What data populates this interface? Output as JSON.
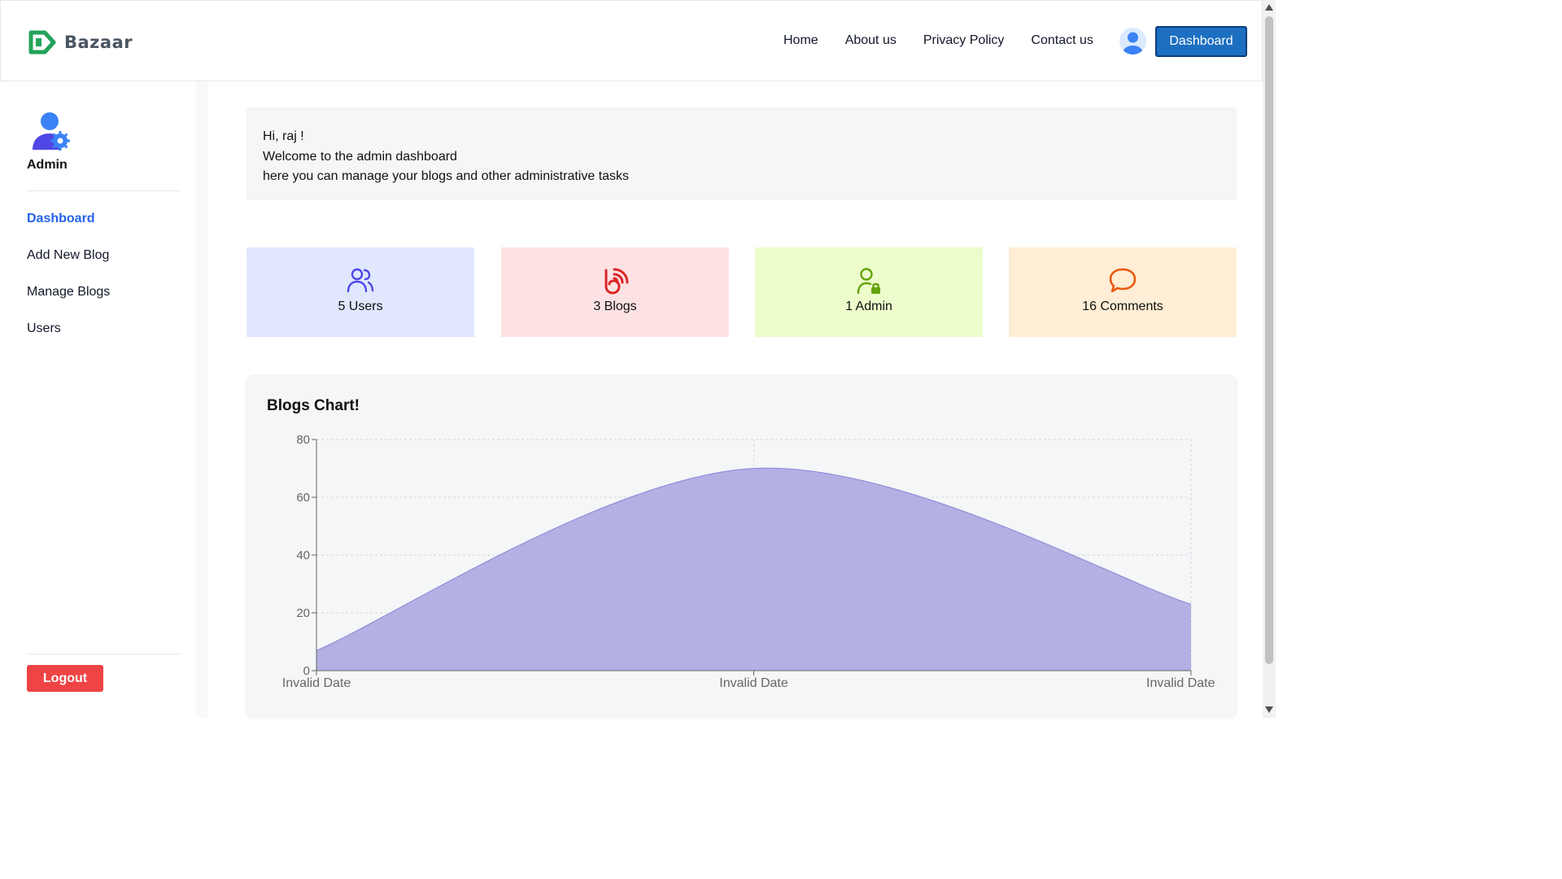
{
  "brand": {
    "name": "Bazaar",
    "accent": "#1d6fc1"
  },
  "nav": {
    "links": [
      "Home",
      "About us",
      "Privacy Policy",
      "Contact us"
    ],
    "avatar_icon": "user-avatar-icon",
    "dashboard_button": "Dashboard"
  },
  "sidebar": {
    "role_label": "Admin",
    "items": [
      {
        "label": "Dashboard",
        "active": true
      },
      {
        "label": "Add New Blog",
        "active": false
      },
      {
        "label": "Manage Blogs",
        "active": false
      },
      {
        "label": "Users",
        "active": false
      }
    ],
    "logout_label": "Logout"
  },
  "welcome": {
    "greeting": "Hi, raj !",
    "line1": "Welcome to the admin dashboard",
    "line2": "here you can manage your blogs and other administrative tasks"
  },
  "stats": [
    {
      "label": "5 Users",
      "icon": "users-icon",
      "color": "#4f46e5"
    },
    {
      "label": "3 Blogs",
      "icon": "blog-icon",
      "color": "#dc2626"
    },
    {
      "label": "1 Admin",
      "icon": "admin-lock-icon",
      "color": "#65a30d"
    },
    {
      "label": "16 Comments",
      "icon": "comment-icon",
      "color": "#ea580c"
    }
  ],
  "chart": {
    "title": "Blogs Chart!"
  },
  "chart_data": {
    "type": "area",
    "categories": [
      "Invalid Date",
      "Invalid Date",
      "Invalid Date"
    ],
    "values": [
      7,
      70,
      23
    ],
    "ylim": [
      0,
      80
    ],
    "yticks": [
      0,
      20,
      40,
      60,
      80
    ],
    "grid": true,
    "fill": "#b3b0e4",
    "stroke": "#8884d8"
  }
}
